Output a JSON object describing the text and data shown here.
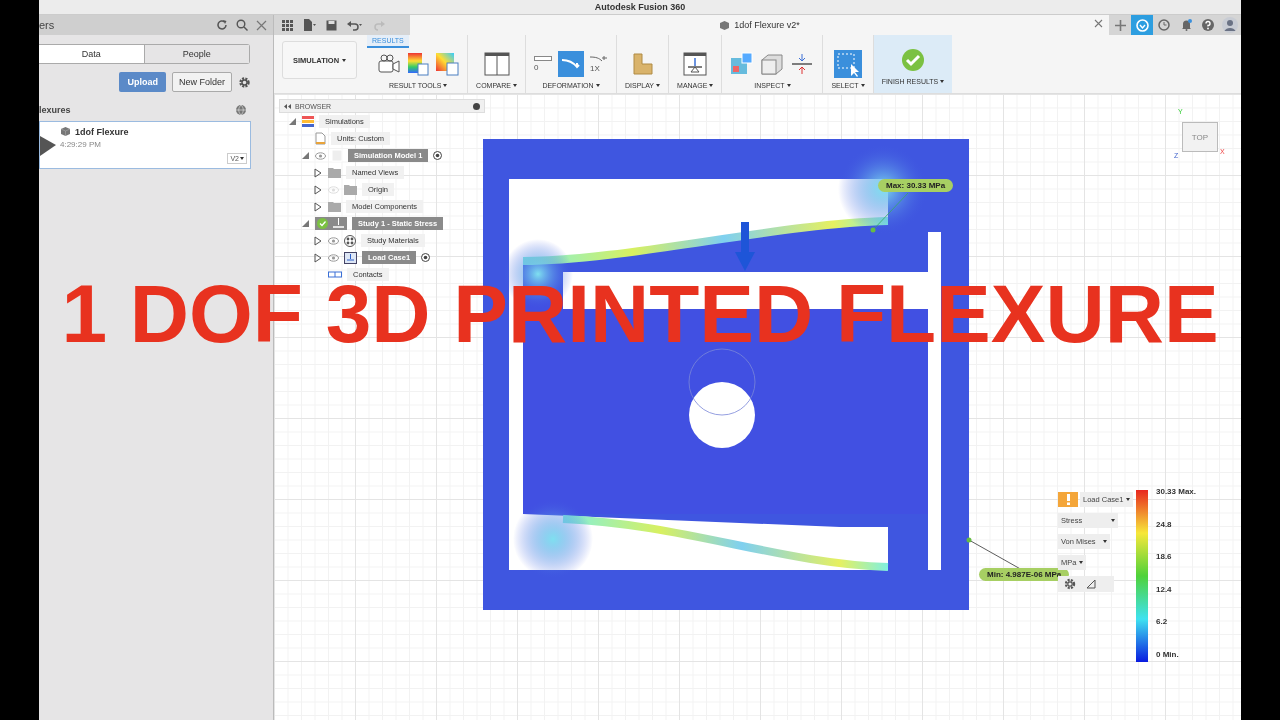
{
  "window": {
    "title": "Autodesk Fusion 360"
  },
  "data_panel": {
    "header": "ers",
    "tabs": [
      {
        "label": "Data",
        "selected": true
      },
      {
        "label": "People",
        "selected": false
      }
    ],
    "upload_button": "Upload",
    "new_folder_button": "New Folder",
    "section_title": "lexures",
    "file_card": {
      "name": "1dof Flexure",
      "time": "4:29:29 PM",
      "version": "V2"
    }
  },
  "document_tab": {
    "title": "1dof Flexure v2*"
  },
  "toolbar": {
    "workspace": "SIMULATION",
    "active_tab": "RESULTS",
    "groups": [
      {
        "label": "RESULT TOOLS",
        "kind": "result"
      },
      {
        "label": "COMPARE",
        "kind": "compare"
      },
      {
        "label": "DEFORMATION",
        "kind": "deformation",
        "scale_labels": [
          "0",
          "1X"
        ]
      },
      {
        "label": "DISPLAY",
        "kind": "display"
      },
      {
        "label": "MANAGE",
        "kind": "manage"
      },
      {
        "label": "INSPECT",
        "kind": "inspect"
      },
      {
        "label": "SELECT",
        "kind": "select"
      },
      {
        "label": "FINISH RESULTS",
        "kind": "finish"
      }
    ]
  },
  "browser": {
    "title": "BROWSER",
    "tree": [
      {
        "label": "Simulations",
        "kind": "sims",
        "expanded": true,
        "active": false,
        "children": [
          {
            "label": "Units: Custom",
            "kind": "doc",
            "active": false
          },
          {
            "label": "Simulation Model 1",
            "kind": "model",
            "expanded": true,
            "active": true,
            "visible": true,
            "radio": true,
            "children": [
              {
                "label": "Named Views",
                "kind": "folder",
                "expanded": false,
                "active": false
              },
              {
                "label": "Origin",
                "kind": "folder",
                "expanded": false,
                "active": false,
                "visible": false
              },
              {
                "label": "Model Components",
                "kind": "folder",
                "expanded": false,
                "active": false
              }
            ]
          },
          {
            "label": "Study 1 - Static Stress",
            "kind": "study",
            "expanded": true,
            "active": true,
            "children": [
              {
                "label": "Study Materials",
                "kind": "materials",
                "expanded": false,
                "active": false,
                "visible": true
              },
              {
                "label": "Load Case1",
                "kind": "load",
                "expanded": false,
                "active": true,
                "visible": true,
                "radio": true
              },
              {
                "label": "Contacts",
                "kind": "contacts",
                "active": false
              }
            ]
          }
        ]
      }
    ]
  },
  "canvas": {
    "max_label": "Max: 30.33 MPa",
    "min_label": "Min: 4.987E-06 MPa",
    "view_cube": {
      "face": "TOP",
      "axes": [
        "Y",
        "X",
        "Z"
      ]
    },
    "legend": {
      "load_case": "Load Case1",
      "result": "Stress",
      "component": "Von Mises",
      "unit": "MPa",
      "scale": [
        "30.33 Max.",
        "24.8",
        "18.6",
        "12.4",
        "6.2",
        "0 Min."
      ]
    }
  },
  "overlay_title": "1 DOF 3D PRINTED FLEXURE"
}
